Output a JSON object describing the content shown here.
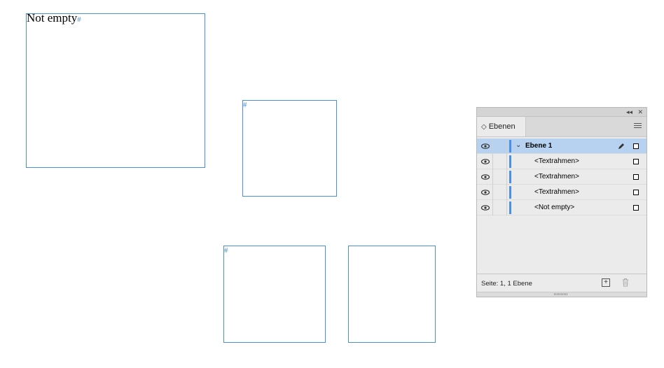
{
  "frames": [
    {
      "text": "Not empty",
      "overflow_marker": "#"
    },
    {
      "text": "",
      "overflow_marker": "#"
    },
    {
      "text": "",
      "overflow_marker": "#"
    },
    {
      "text": "",
      "overflow_marker": ""
    }
  ],
  "layers_panel": {
    "tab_label": "Ebenen",
    "tab_arrows": "◇",
    "collapse_glyph": "◂◂",
    "close_glyph": "✕",
    "layer": {
      "name": "Ebene 1",
      "chevron": "⌄"
    },
    "items": [
      {
        "label": "<Textrahmen>"
      },
      {
        "label": "<Textrahmen>"
      },
      {
        "label": "<Textrahmen>"
      },
      {
        "label": "<Not empty>"
      }
    ],
    "status": "Seite: 1, 1 Ebene",
    "new_layer_glyph": "+",
    "colors": {
      "layer_color": "#4a8fe8",
      "selection": "#b7d2f0",
      "frame_edge": "#4a90d9"
    },
    "icons": [
      "eye-icon",
      "pen-icon",
      "new-layer-icon",
      "trash-icon",
      "panel-menu-icon"
    ]
  }
}
